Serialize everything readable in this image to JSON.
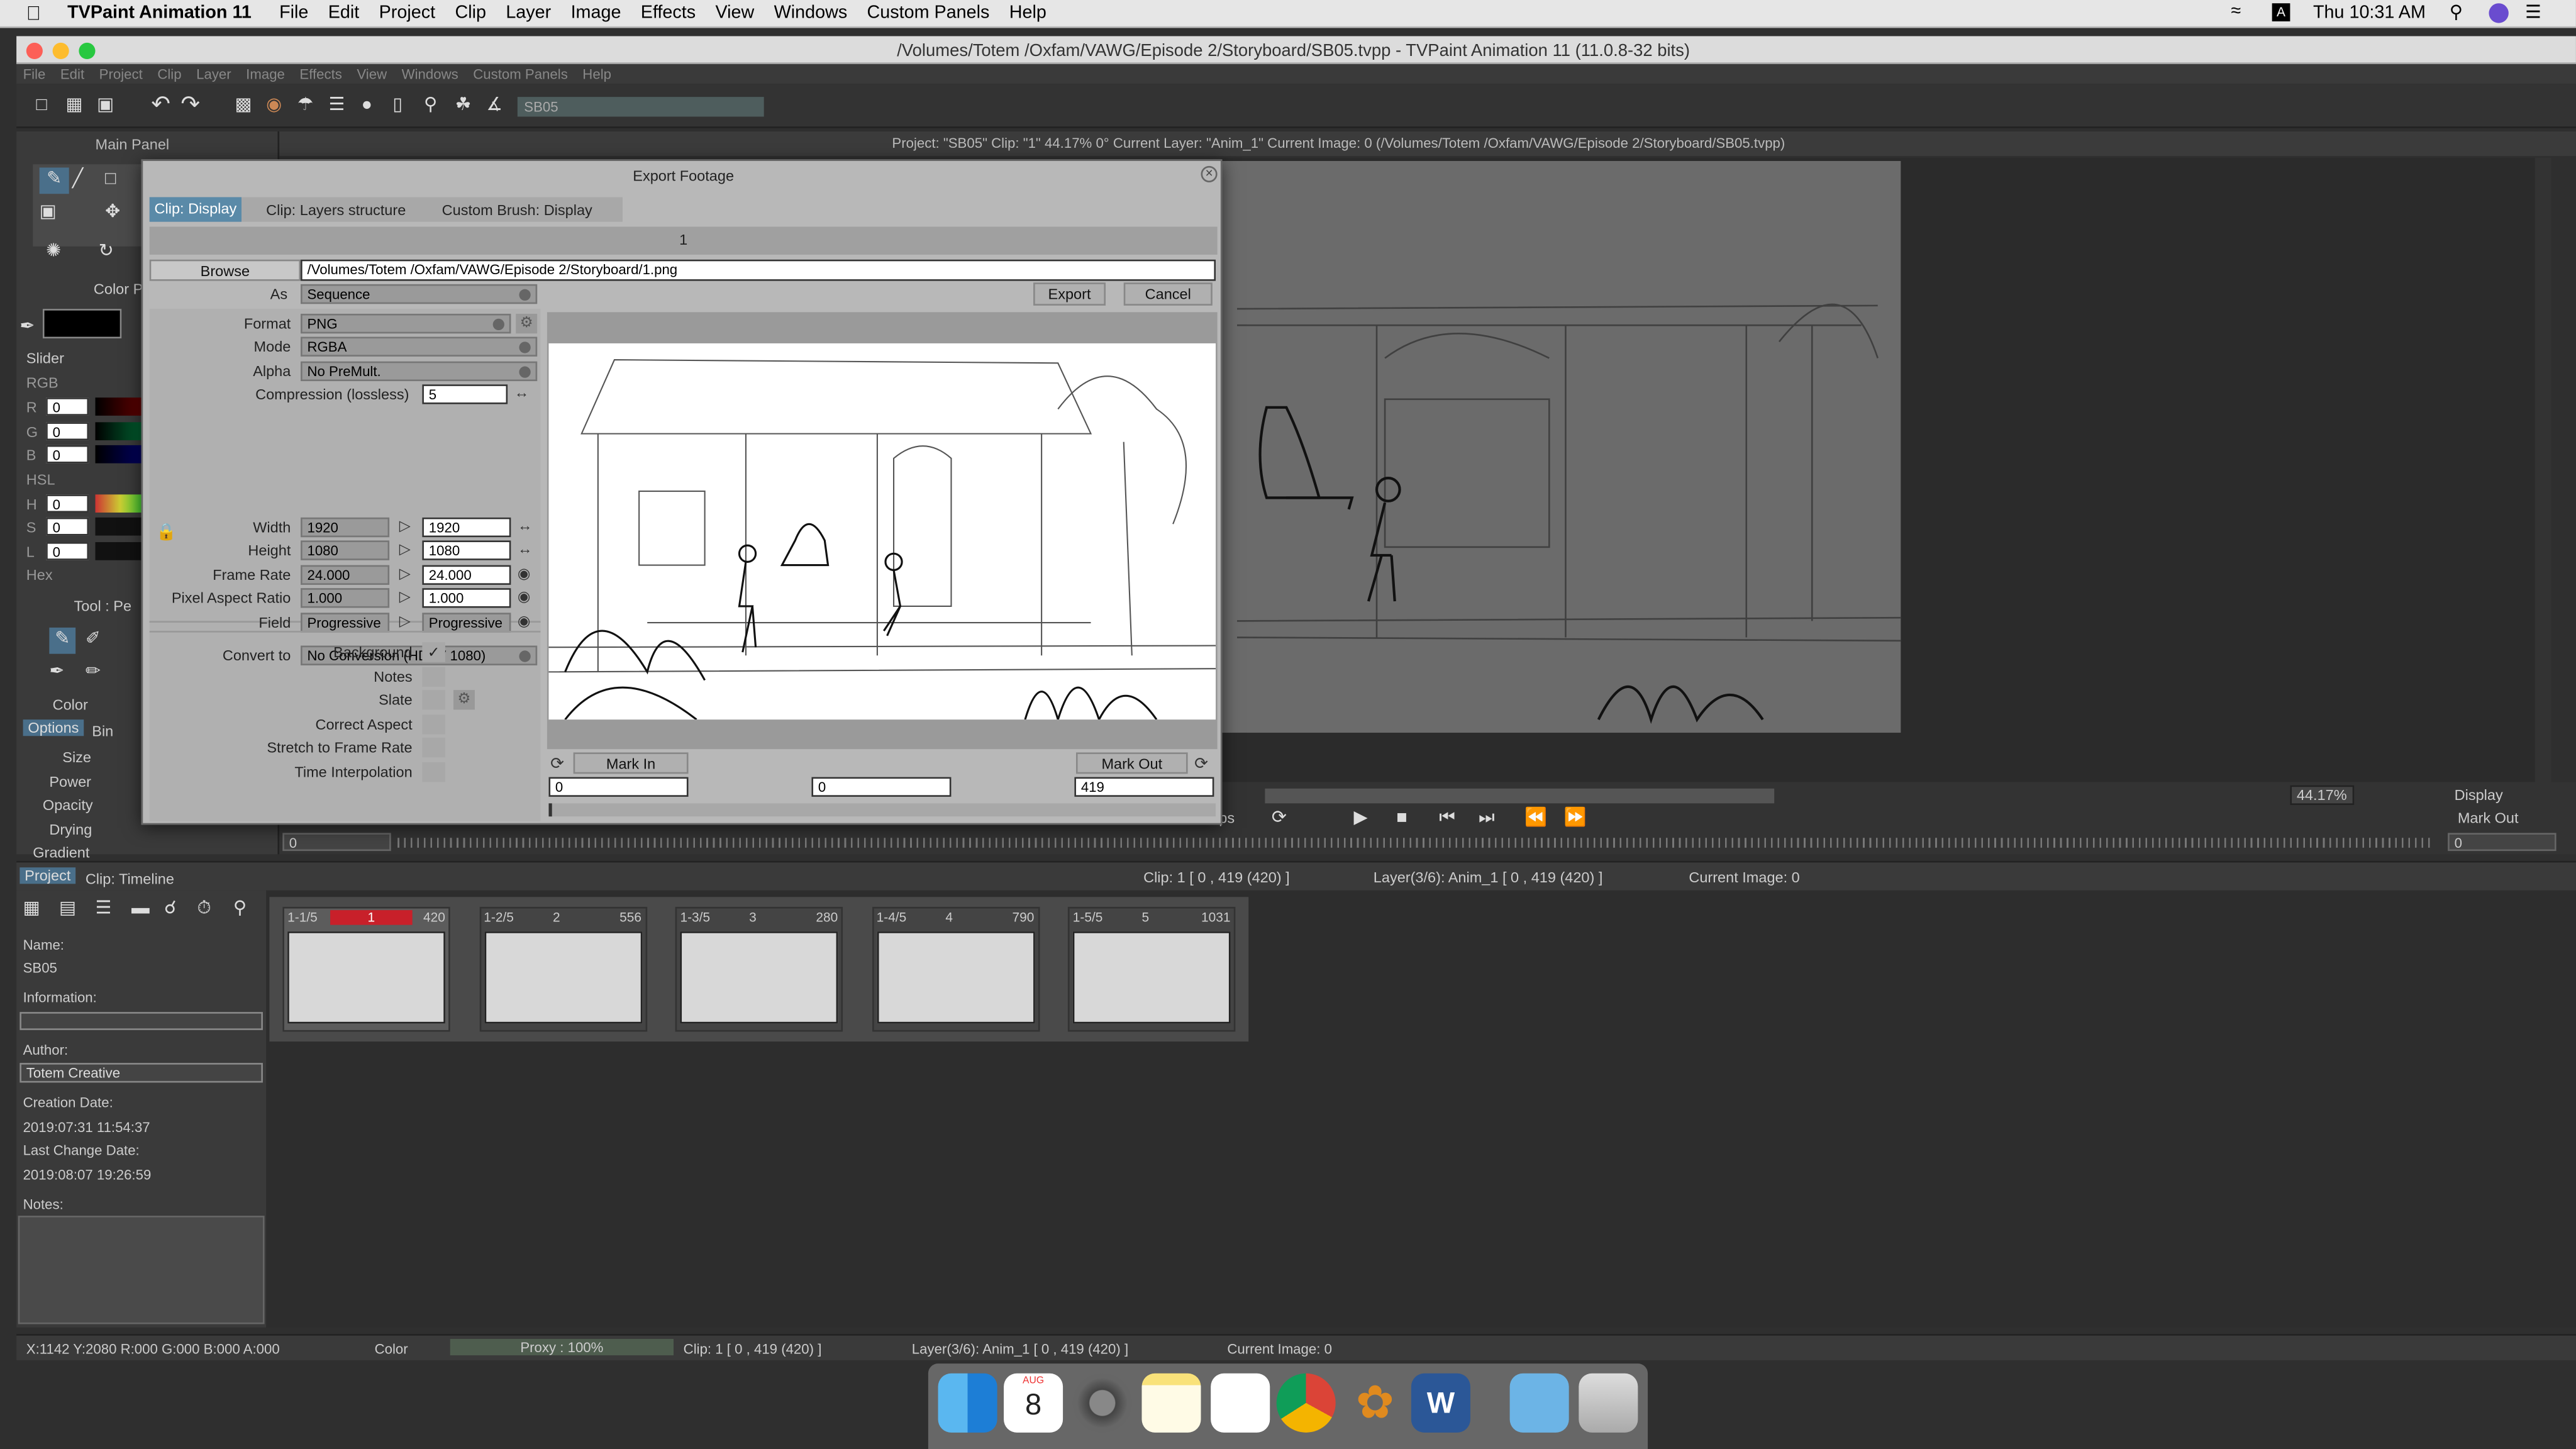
{
  "menubar": {
    "app": "TVPaint Animation 11",
    "items": [
      "File",
      "Edit",
      "Project",
      "Clip",
      "Layer",
      "Image",
      "Effects",
      "View",
      "Windows",
      "Custom Panels",
      "Help"
    ],
    "clock": "Thu 10:31 AM"
  },
  "window": {
    "title": "/Volumes/Totem /Oxfam/VAWG/Episode 2/Storyboard/SB05.tvpp - TVPaint Animation 11 (11.0.8-32 bits)",
    "menu": [
      "File",
      "Edit",
      "Project",
      "Clip",
      "Layer",
      "Image",
      "Effects",
      "View",
      "Windows",
      "Custom Panels",
      "Help"
    ],
    "project_field": "SB05"
  },
  "infobar": "Project: \"SB05\"  Clip: \"1\"  44.17%  0°  Current Layer: \"Anim_1\"  Current Image: 0 (/Volumes/Totem /Oxfam/VAWG/Episode 2/Storyboard/SB05.tvpp)",
  "main_panel": {
    "title": "Main Panel",
    "color_label": "Color P",
    "slider": "Slider",
    "rgb": "RGB",
    "hsl": "HSL",
    "hex": "Hex",
    "r": "0",
    "g": "0",
    "b": "0",
    "h": "0",
    "s": "0",
    "l": "0",
    "R": "R",
    "G": "G",
    "B": "B",
    "H": "H",
    "S": "S",
    "L": "L",
    "tool": "Tool : Pe",
    "color": "Color",
    "tabs": [
      "Options",
      "Bin"
    ],
    "size": "Size",
    "power": "Power",
    "opacity": "Opacity",
    "drying": "Drying",
    "gradient": "Gradient"
  },
  "dialog": {
    "title": "Export Footage",
    "tabs": [
      "Clip: Display",
      "Clip: Layers structure",
      "Custom Brush: Display"
    ],
    "frame_label": "1",
    "browse": "Browse",
    "path": "/Volumes/Totem /Oxfam/VAWG/Episode 2/Storyboard/1.png",
    "as_label": "As",
    "as_value": "Sequence",
    "export": "Export",
    "cancel": "Cancel",
    "format_label": "Format",
    "format_value": "PNG",
    "mode_label": "Mode",
    "mode_value": "RGBA",
    "alpha_label": "Alpha",
    "alpha_value": "No PreMult.",
    "compression_label": "Compression (lossless)",
    "compression_value": "5",
    "convert_label": "Convert to",
    "convert_value": "No Conversion (HDTV 1080)",
    "width_label": "Width",
    "width_a": "1920",
    "width_b": "1920",
    "height_label": "Height",
    "height_a": "1080",
    "height_b": "1080",
    "framerate_label": "Frame Rate",
    "framerate_a": "24.000",
    "framerate_b": "24.000",
    "par_label": "Pixel Aspect Ratio",
    "par_a": "1.000",
    "par_b": "1.000",
    "field_label": "Field",
    "field_a": "Progressive",
    "field_b": "Progressive",
    "background": "Background",
    "notes": "Notes",
    "slate": "Slate",
    "correct_aspect": "Correct Aspect",
    "stretch": "Stretch to Frame Rate",
    "time_interp": "Time Interpolation",
    "mark_in": "Mark In",
    "mark_out": "Mark Out",
    "in_value": "0",
    "mid_value": "0",
    "out_value": "419"
  },
  "viewport": {
    "zoom": "44.17%",
    "display": "Display",
    "mark_out": "Mark Out",
    "frame": "0",
    "right_frame": "0",
    "fps_suffix": "ps"
  },
  "timeline_header": {
    "tabs": [
      "Project",
      "Clip: Timeline"
    ],
    "clip": "Clip: 1 [ 0 , 419  (420) ]",
    "layer": "Layer(3/6): Anim_1 [ 0 , 419  (420) ]",
    "current": "Current Image: 0"
  },
  "project_panel": {
    "name_label": "Name:",
    "name": "SB05",
    "info_label": "Information:",
    "author_label": "Author:",
    "author": "Totem Creative",
    "creation_label": "Creation Date:",
    "creation": "2019:07:31 11:54:37",
    "change_label": "Last Change Date:",
    "change": "2019:08:07 19:26:59",
    "notes_label": "Notes:"
  },
  "clips": [
    {
      "idx": "1-1/5",
      "num": "1",
      "frames": "420"
    },
    {
      "idx": "1-2/5",
      "num": "2",
      "frames": "556"
    },
    {
      "idx": "1-3/5",
      "num": "3",
      "frames": "280"
    },
    {
      "idx": "1-4/5",
      "num": "4",
      "frames": "790"
    },
    {
      "idx": "1-5/5",
      "num": "5",
      "frames": "1031"
    }
  ],
  "statusbar": {
    "coords": "X:1142  Y:2080  R:000 G:000 B:000 A:000",
    "color": "Color",
    "proxy": "Proxy : 100%",
    "clip": "Clip: 1 [ 0 , 419  (420) ]",
    "layer": "Layer(3/6): Anim_1 [ 0 , 419  (420) ]",
    "current": "Current Image: 0"
  },
  "dock": {
    "calendar_month": "AUG",
    "calendar_day": "8"
  }
}
